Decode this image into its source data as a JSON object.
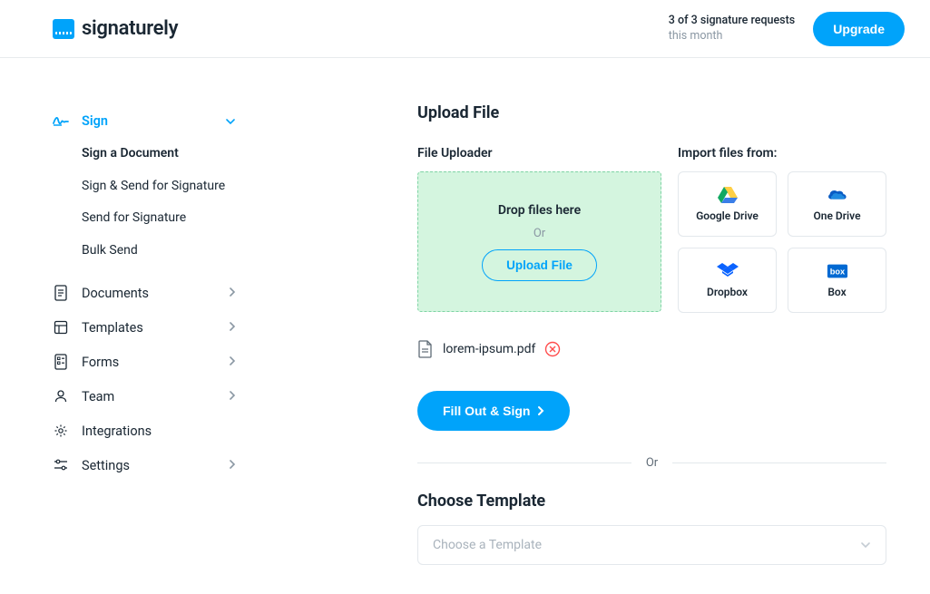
{
  "header": {
    "brand": "signaturely",
    "usage_line1": "3 of 3 signature requests",
    "usage_line2": "this month",
    "upgrade_label": "Upgrade"
  },
  "sidebar": {
    "items": [
      {
        "label": "Sign",
        "expanded": true
      },
      {
        "label": "Documents"
      },
      {
        "label": "Templates"
      },
      {
        "label": "Forms"
      },
      {
        "label": "Team"
      },
      {
        "label": "Integrations"
      },
      {
        "label": "Settings"
      }
    ],
    "sign_subitems": [
      "Sign a Document",
      "Sign & Send for Signature",
      "Send for Signature",
      "Bulk Send"
    ]
  },
  "main": {
    "upload_title": "Upload File",
    "uploader_label": "File Uploader",
    "drop_title": "Drop files here",
    "drop_or": "Or",
    "upload_btn": "Upload File",
    "import_label": "Import files from:",
    "import_sources": [
      "Google Drive",
      "One Drive",
      "Dropbox",
      "Box"
    ],
    "uploaded_file": "lorem-ipsum.pdf",
    "fill_btn": "Fill Out & Sign",
    "divider_or": "Or",
    "template_title": "Choose Template",
    "template_placeholder": "Choose a Template"
  }
}
